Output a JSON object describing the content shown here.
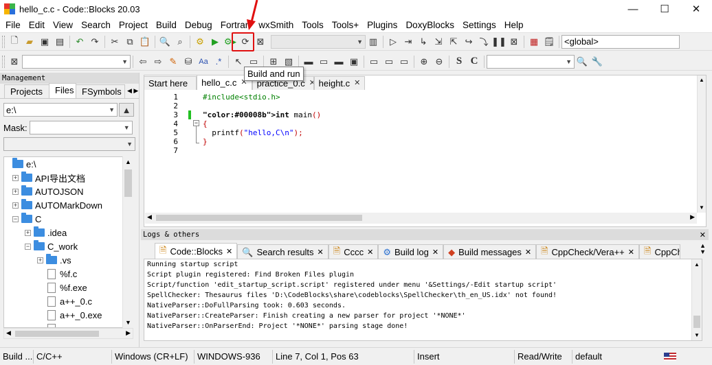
{
  "window": {
    "title": "hello_c.c - Code::Blocks 20.03",
    "minimize": "—",
    "maximize": "☐",
    "close": "✕"
  },
  "menu": [
    "File",
    "Edit",
    "View",
    "Search",
    "Project",
    "Build",
    "Debug",
    "Fortran",
    "wxSmith",
    "Tools",
    "Tools+",
    "Plugins",
    "DoxyBlocks",
    "Settings",
    "Help"
  ],
  "toolbar": {
    "scope_combo": "<global>",
    "tooltip": "Build and run"
  },
  "management": {
    "title": "Management",
    "tabs": [
      "Projects",
      "Files",
      "FSymbols"
    ],
    "active_tab": "Files",
    "path": "e:\\",
    "mask_label": "Mask:",
    "tree": [
      {
        "label": "e:\\",
        "indent": 0,
        "kind": "folder",
        "exp": ""
      },
      {
        "label": "API导出文档",
        "indent": 1,
        "kind": "folder",
        "exp": "+"
      },
      {
        "label": "AUTOJSON",
        "indent": 1,
        "kind": "folder",
        "exp": "+"
      },
      {
        "label": "AUTOMarkDown",
        "indent": 1,
        "kind": "folder",
        "exp": "+"
      },
      {
        "label": "C",
        "indent": 1,
        "kind": "folder",
        "exp": "−"
      },
      {
        "label": ".idea",
        "indent": 2,
        "kind": "folder",
        "exp": "+"
      },
      {
        "label": "C_work",
        "indent": 2,
        "kind": "folder",
        "exp": "−"
      },
      {
        "label": ".vs",
        "indent": 3,
        "kind": "folder",
        "exp": "+"
      },
      {
        "label": "%f.c",
        "indent": 3,
        "kind": "file",
        "exp": ""
      },
      {
        "label": "%f.exe",
        "indent": 3,
        "kind": "file",
        "exp": ""
      },
      {
        "label": "a++_0.c",
        "indent": 3,
        "kind": "file",
        "exp": ""
      },
      {
        "label": "a++_0.exe",
        "indent": 3,
        "kind": "file",
        "exp": ""
      },
      {
        "label": "a.exe",
        "indent": 3,
        "kind": "file",
        "exp": ""
      }
    ]
  },
  "editor": {
    "tabs": [
      {
        "label": "Start here",
        "close": ""
      },
      {
        "label": "hello_c.c",
        "close": "✕"
      },
      {
        "label": "practice_0.c",
        "close": "✕"
      },
      {
        "label": "height.c",
        "close": "✕"
      }
    ],
    "active_tab": "hello_c.c",
    "lines": [
      {
        "n": "1",
        "text": "#include<stdio.h>"
      },
      {
        "n": "2",
        "text": ""
      },
      {
        "n": "3",
        "text": "int main()"
      },
      {
        "n": "4",
        "text": "{"
      },
      {
        "n": "5",
        "text": "  printf(\"hello,C\\n\");"
      },
      {
        "n": "6",
        "text": "}"
      },
      {
        "n": "7",
        "text": ""
      }
    ]
  },
  "logs": {
    "title": "Logs & others",
    "tabs": [
      {
        "label": "Code::Blocks",
        "close": "✕"
      },
      {
        "label": "Search results",
        "close": "✕"
      },
      {
        "label": "Cccc",
        "close": "✕"
      },
      {
        "label": "Build log",
        "close": "✕"
      },
      {
        "label": "Build messages",
        "close": "✕"
      },
      {
        "label": "CppCheck/Vera++",
        "close": "✕"
      },
      {
        "label": "CppChe",
        "close": ""
      }
    ],
    "lines": [
      "Running startup script",
      "Script plugin registered: Find Broken Files plugin",
      "Script/function 'edit_startup_script.script' registered under menu '&Settings/-Edit startup script'",
      "SpellChecker: Thesaurus files 'D:\\CodeBlocks\\share\\codeblocks\\SpellChecker\\th_en_US.idx' not found!",
      "NativeParser::DoFullParsing took: 0.603 seconds.",
      "NativeParser::CreateParser: Finish creating a new parser for project '*NONE*'",
      "NativeParser::OnParserEnd: Project '*NONE*' parsing stage done!"
    ]
  },
  "status": {
    "build": "Build ...",
    "language": "C/C++",
    "eol": "Windows (CR+LF)",
    "encoding": "WINDOWS-936",
    "position": "Line 7, Col 1, Pos 63",
    "mode": "Insert",
    "access": "Read/Write",
    "profile": "default"
  },
  "colors": {
    "highlight": "#e01010",
    "keyword": "#00008b",
    "string": "#0000ff",
    "preprocessor": "#008000",
    "folder": "#3c8de0"
  }
}
